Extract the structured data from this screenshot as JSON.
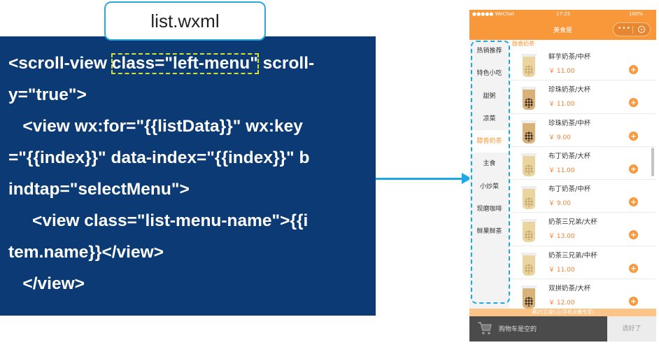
{
  "file_tab": "list.wxml",
  "code": {
    "line1_a": "<scroll-view ",
    "line1_hl": "class=\"left-menu\"",
    "line1_b": " scroll-",
    "line2": "y=\"true\">",
    "line3": "   <view wx:for=\"{{listData}}\" wx:key",
    "line4": "=\"{{index}}\" data-index=\"{{index}}\" b",
    "line5": "indtap=\"selectMenu\">",
    "line6": "     <view class=\"list-menu-name\">{{i",
    "line7": "tem.name}}</view>",
    "line8": "   </view>"
  },
  "phone": {
    "status": {
      "carrier": "●●●●● WeChat",
      "time": "17:25",
      "battery": "100%"
    },
    "nav_title": "美食屋",
    "capsule_dots": "•••",
    "menu": [
      "热销推荐",
      "特色小吃",
      "甜粥",
      "凉菜",
      "醇香奶茶",
      "主食",
      "小炒菜",
      "现磨咖啡",
      "鲜果鲜茶"
    ],
    "active_menu_index": 4,
    "category_title": "醇香奶茶",
    "items": [
      {
        "name": "鲜芋奶茶/中杯",
        "price": "￥ 11.00"
      },
      {
        "name": "珍珠奶茶/大杯",
        "price": "￥ 11.00"
      },
      {
        "name": "珍珠奶茶/中杯",
        "price": "￥ 9.00"
      },
      {
        "name": "布丁奶茶/大杯",
        "price": "￥ 11.00"
      },
      {
        "name": "布丁奶茶/中杯",
        "price": "￥ 9.00"
      },
      {
        "name": "奶茶三兄弟/大杯",
        "price": "￥ 13.00"
      },
      {
        "name": "奶茶三兄弟/中杯",
        "price": "￥ 11.00"
      },
      {
        "name": "双拼奶茶/大杯",
        "price": "￥ 12.00"
      }
    ],
    "add_symbol": "+",
    "promo": "满25立减5元(手机点餐专享)",
    "cart_text": "购物车是空的",
    "checkout": "选好了"
  },
  "colors": {
    "code_bg": "#0b3a74",
    "accent": "#f8983b",
    "arrow": "#1ea9e6",
    "highlight": "#d6e135"
  }
}
